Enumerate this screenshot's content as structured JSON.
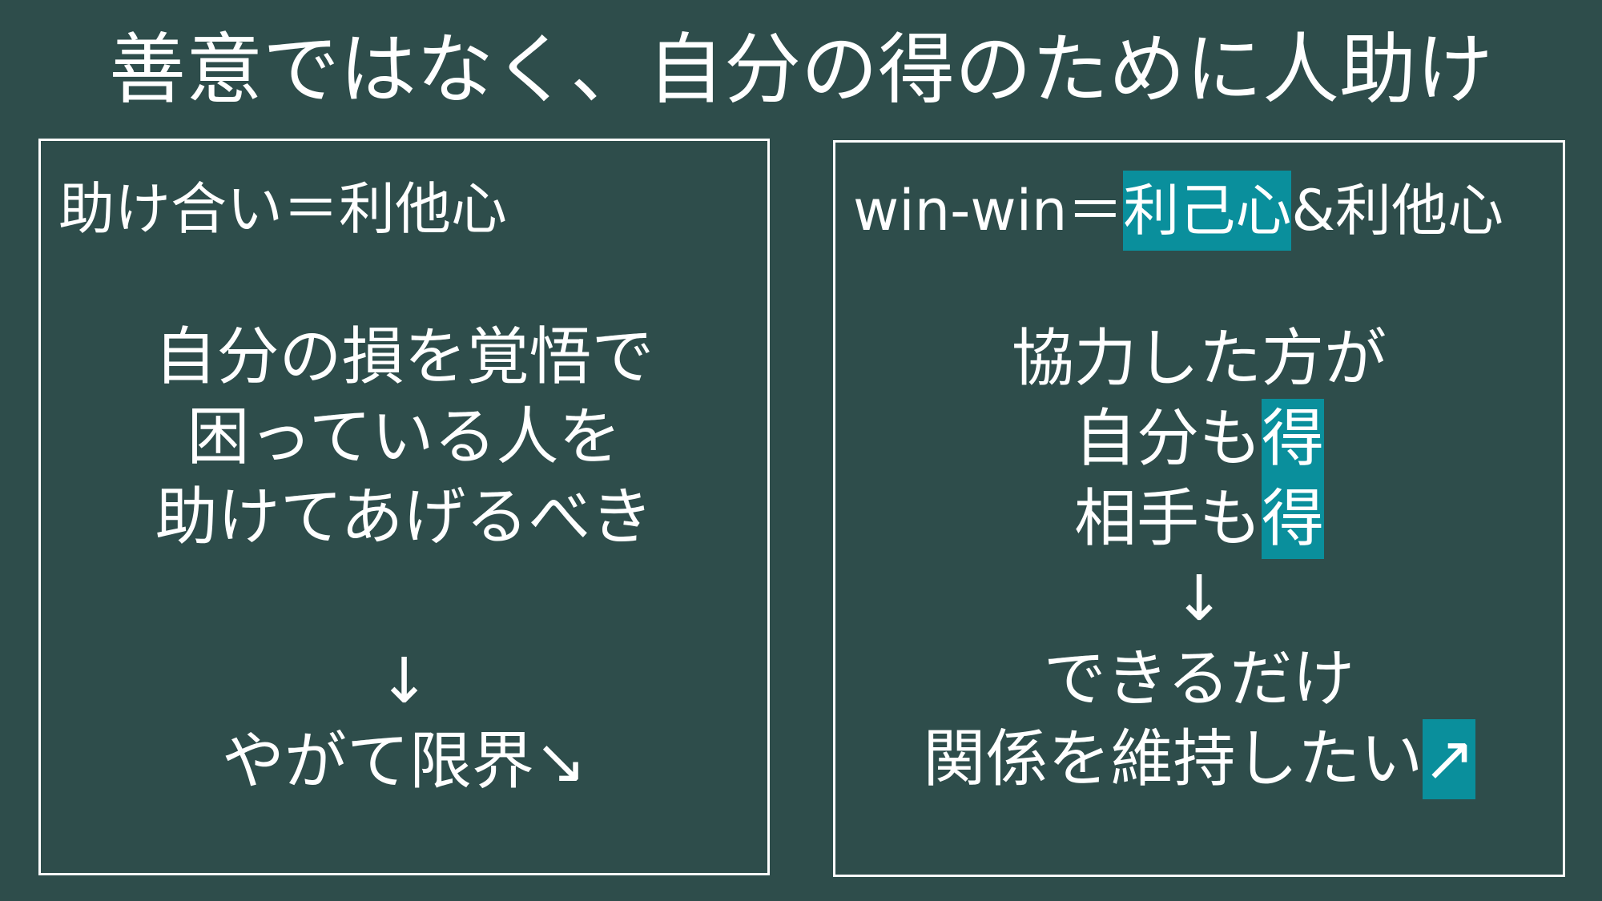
{
  "slide": {
    "title": "善意ではなく、自分の得のために人助け"
  },
  "left_panel": {
    "heading": "助け合い＝利他心",
    "lines": [
      "自分の損を覚悟で",
      "困っている人を",
      "助けてあげるべき"
    ],
    "arrow": "↓",
    "conclusion": "やがて限界↘"
  },
  "right_panel": {
    "heading_prefix": "win-win＝",
    "heading_highlight": "利己心",
    "heading_suffix": "&利他心",
    "line1": "協力した方が",
    "line2_prefix": "自分も",
    "line2_highlight": "得",
    "line3_prefix": "相手も",
    "line3_highlight": "得",
    "arrow": "↓",
    "line4": "できるだけ",
    "line5_prefix": "関係を維持したい",
    "line5_highlight": "↗"
  },
  "colors": {
    "background": "#2e4d4b",
    "highlight": "#0a8f9c",
    "text": "#ffffff"
  }
}
